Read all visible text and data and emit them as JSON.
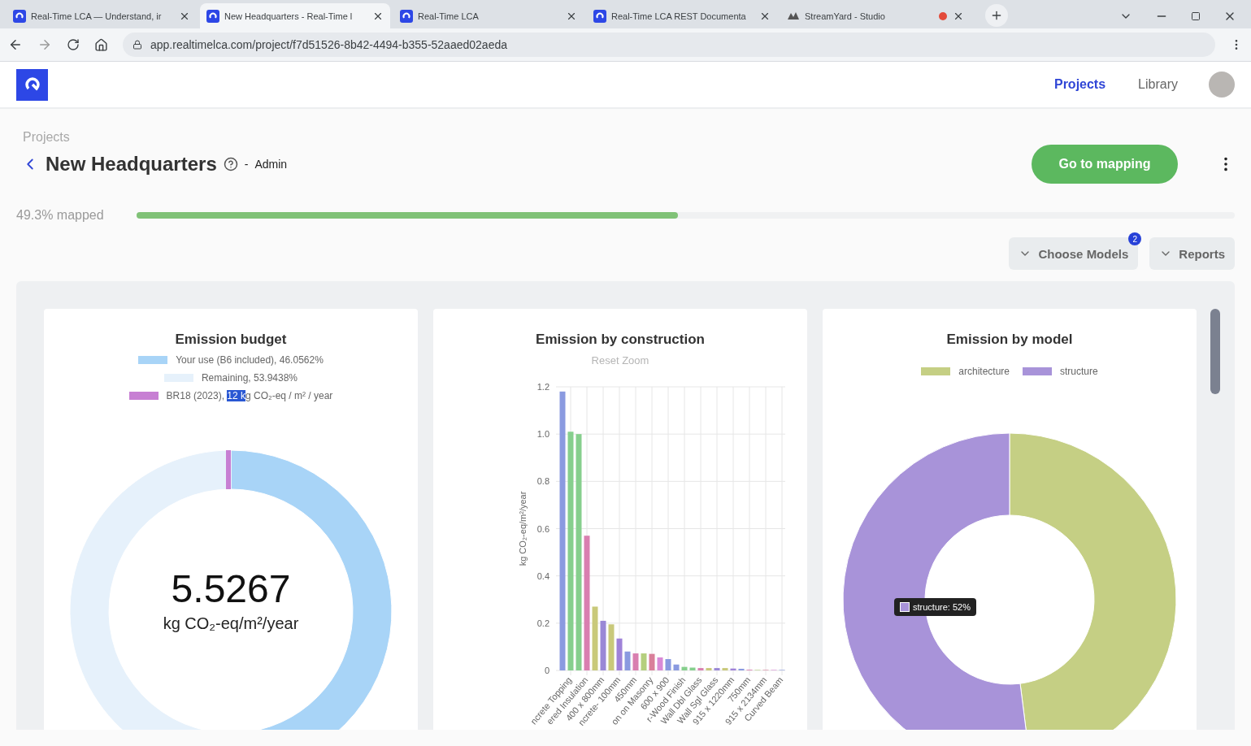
{
  "browser": {
    "tabs": [
      {
        "title": "Real-Time LCA — Understand, ir",
        "kind": "app",
        "selected": false,
        "recording": false
      },
      {
        "title": "New Headquarters - Real-Time l",
        "kind": "app",
        "selected": true,
        "recording": false
      },
      {
        "title": "Real-Time LCA",
        "kind": "app",
        "selected": false,
        "recording": false
      },
      {
        "title": "Real-Time LCA REST Documenta",
        "kind": "app",
        "selected": false,
        "recording": false
      },
      {
        "title": "StreamYard - Studio",
        "kind": "studio",
        "selected": false,
        "recording": true
      }
    ],
    "url": "app.realtimelca.com/project/f7d51526-8b42-4494-b355-52aaed02aeda"
  },
  "nav": [
    {
      "label": "Projects",
      "selected": true
    },
    {
      "label": "Library",
      "selected": false
    }
  ],
  "breadcrumb": "Projects",
  "project": {
    "title": "New Headquarters",
    "role_separator": "-",
    "role": "Admin",
    "primary_button": "Go to mapping"
  },
  "progress": {
    "label": "49.3% mapped",
    "level": 0.493
  },
  "actions": [
    {
      "label": "Choose Models",
      "badge": "2"
    },
    {
      "label": "Reports"
    }
  ],
  "budget": {
    "title": "Emission budget",
    "legend": [
      {
        "color": "#a8d4f7",
        "label_parts": [
          {
            "text": "Your use (B6 included), 46.0562%",
            "highlighted": false
          }
        ]
      },
      {
        "color": "#e6f1fb",
        "label_parts": [
          {
            "text": "Remaining, 53.9438%",
            "highlighted": false
          }
        ]
      },
      {
        "color": "#c77fd3",
        "label_parts": [
          {
            "text": "BR18 (2023), ",
            "highlighted": false
          },
          {
            "text": "12 k",
            "highlighted": true
          },
          {
            "text": "g CO₂-eq / m² / year",
            "highlighted": false
          }
        ]
      }
    ],
    "chart_data": {
      "type": "donut",
      "values": [
        46.0562,
        53.9438
      ],
      "colors": [
        "#a8d4f7",
        "#e6f1fb"
      ]
    },
    "value": "5.5267",
    "unit": "kg CO₂-eq/m²/year"
  },
  "construction": {
    "subtitle": "Reset Zoom",
    "chart_data": {
      "type": "bar",
      "title": "Emission by construction",
      "ylabel": "kg CO₂-eq/m²/year",
      "ylim": [
        0,
        1.2
      ],
      "grid": true,
      "yticks": [
        0,
        0.2,
        0.4,
        0.6,
        0.8,
        {
          "value": 1,
          "label": "1.0"
        },
        1.2
      ],
      "values": [
        1.18,
        1.01,
        1.0,
        0.57,
        0.27,
        0.21,
        0.195,
        0.135,
        0.08,
        0.072,
        0.072,
        0.07,
        0.055,
        0.048,
        0.025,
        0.015,
        0.012,
        0.01,
        0.01,
        0.01,
        0.01,
        0.008,
        0.007,
        0.003,
        0.002,
        0.002,
        0.002,
        0.002
      ],
      "categories": [
        null,
        "ncrete Topping",
        null,
        "ered Insulation",
        null,
        "400 x 800mm",
        null,
        "ncrete- 100mm",
        null,
        "450mm",
        null,
        "on on Masonry",
        null,
        "600 x 900",
        null,
        "r-Wood Finish",
        null,
        "Wall Dbl Glass",
        null,
        "Wall Sgl Glass",
        null,
        "915 x 1220mm",
        null,
        "750mm",
        null,
        "915 x 2134mm",
        null,
        "Curved Beam"
      ]
    }
  },
  "model": {
    "chart_data": {
      "type": "donut",
      "title": "Emission by model",
      "categories": [
        "architecture",
        "structure"
      ],
      "values": [
        48,
        52
      ],
      "colors": [
        "#c5cf84",
        "#a893d9"
      ]
    },
    "tooltip": {
      "text": "structure: 52%",
      "color": "#a893d9"
    }
  }
}
